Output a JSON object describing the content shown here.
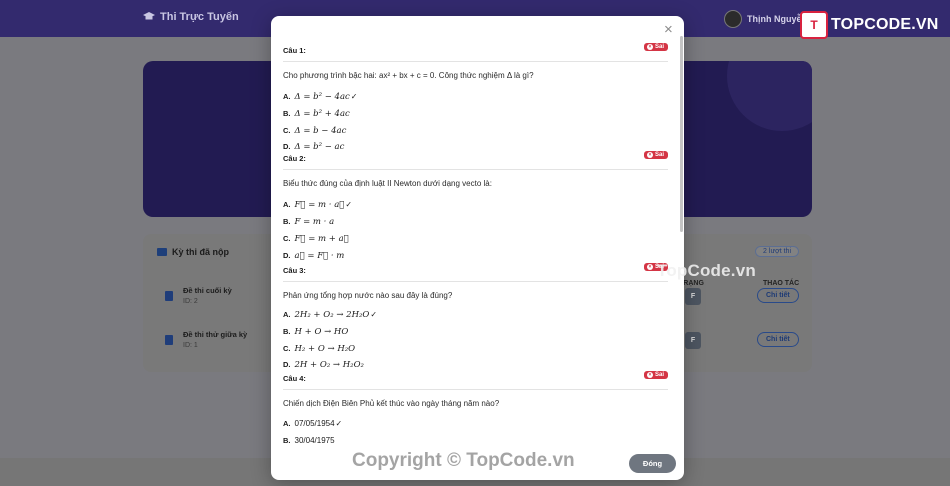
{
  "navbar": {
    "brand": "Thi Trực Tuyến",
    "user_name": "Thịnh Nguyễn"
  },
  "logo": {
    "mark": "T",
    "text": "TOPCODE.VN"
  },
  "history": {
    "title": "Kỳ thi đã nộp",
    "count_badge": "2 lượt thi",
    "col_status": "TRẠNG",
    "col_action": "THAO TÁC",
    "rows": [
      {
        "name": "Đề thi cuối kỳ",
        "id": "ID: 2",
        "grade": "F",
        "action": "Chi tiết"
      },
      {
        "name": "Đề thi thử giữa kỳ",
        "id": "ID: 1",
        "grade": "F",
        "action": "Chi tiết"
      }
    ]
  },
  "modal": {
    "close_glyph": "×",
    "badge_wrong": "Sai",
    "questions": [
      {
        "label": "Câu 1:",
        "text": "Cho phương trình bậc hai: ax² + bx + c = 0. Công thức nghiệm Δ là gì?",
        "options": [
          {
            "letter": "A.",
            "text": "Δ = b² − 4ac",
            "check": "✓"
          },
          {
            "letter": "B.",
            "text": "Δ = b² + 4ac",
            "check": ""
          },
          {
            "letter": "C.",
            "text": "Δ = b − 4ac",
            "check": ""
          },
          {
            "letter": "D.",
            "text": "Δ = b² − ac",
            "check": ""
          }
        ]
      },
      {
        "label": "Câu 2:",
        "text": "Biểu thức đúng của định luật II Newton dưới dạng vecto là:",
        "options": [
          {
            "letter": "A.",
            "text": "F⃗ = m · a⃗",
            "check": "✓"
          },
          {
            "letter": "B.",
            "text": "F = m · a",
            "check": ""
          },
          {
            "letter": "C.",
            "text": "F⃗ = m + a⃗",
            "check": ""
          },
          {
            "letter": "D.",
            "text": "a⃗ = F⃗ · m",
            "check": ""
          }
        ]
      },
      {
        "label": "Câu 3:",
        "text": "Phản ứng tổng hợp nước nào sau đây là đúng?",
        "options": [
          {
            "letter": "A.",
            "text": "2H₂ + O₂ → 2H₂O",
            "check": "✓"
          },
          {
            "letter": "B.",
            "text": "H + O → HO",
            "check": ""
          },
          {
            "letter": "C.",
            "text": "H₂ + O → H₂O",
            "check": ""
          },
          {
            "letter": "D.",
            "text": "2H + O₂ → H₂O₂",
            "check": ""
          }
        ]
      },
      {
        "label": "Câu 4:",
        "text": "Chiến dịch Điện Biên Phủ kết thúc vào ngày tháng năm nào?",
        "options": [
          {
            "letter": "A.",
            "text": "07/05/1954",
            "check": "✓"
          },
          {
            "letter": "B.",
            "text": "30/04/1975",
            "check": ""
          }
        ]
      }
    ],
    "close_button": "Đóng"
  },
  "watermarks": {
    "middle": "TopCode.vn",
    "bottom": "Copyright © TopCode.vn"
  }
}
